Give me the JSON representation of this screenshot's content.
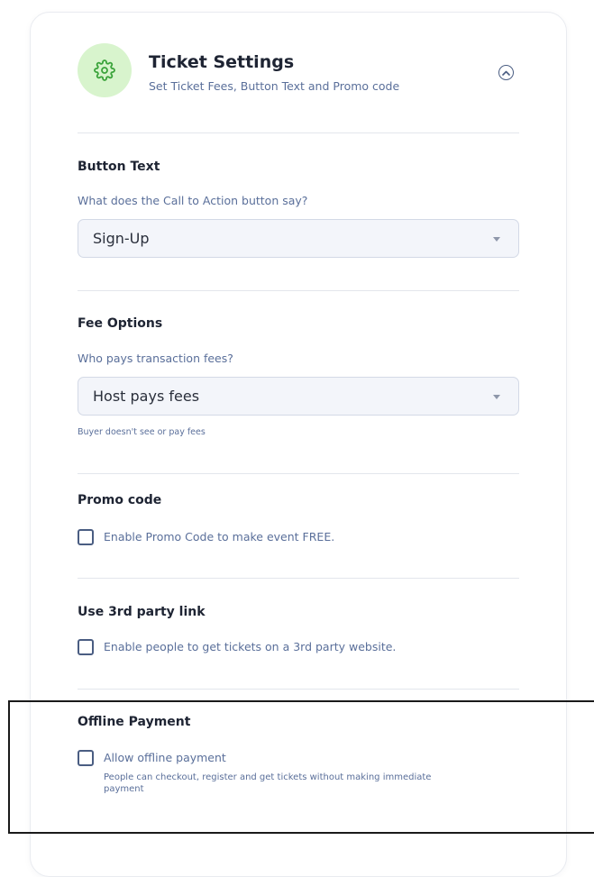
{
  "header": {
    "icon": "gear-icon",
    "title": "Ticket Settings",
    "subtitle": "Set Ticket Fees, Button Text and Promo code",
    "collapse_icon": "chevron-up-circle-icon"
  },
  "button_text": {
    "title": "Button Text",
    "question": "What does the Call to Action button say?",
    "selected": "Sign-Up"
  },
  "fee_options": {
    "title": "Fee Options",
    "question": "Who pays transaction fees?",
    "selected": "Host pays fees",
    "helper": "Buyer doesn't see or pay fees"
  },
  "promo_code": {
    "title": "Promo code",
    "checkbox_label": "Enable Promo Code to make event FREE.",
    "checked": false
  },
  "third_party": {
    "title": "Use 3rd party link",
    "checkbox_label": "Enable people to get tickets on a 3rd party website.",
    "checked": false
  },
  "offline_payment": {
    "title": "Offline Payment",
    "checkbox_label": "Allow offline payment",
    "description": "People can checkout, register and get tickets without making immediate payment",
    "checked": false
  },
  "colors": {
    "accent_green_bg": "#d8f4cd",
    "accent_green": "#3aa33a",
    "muted_blue": "#5a6f9a",
    "heading": "#1e2433"
  }
}
